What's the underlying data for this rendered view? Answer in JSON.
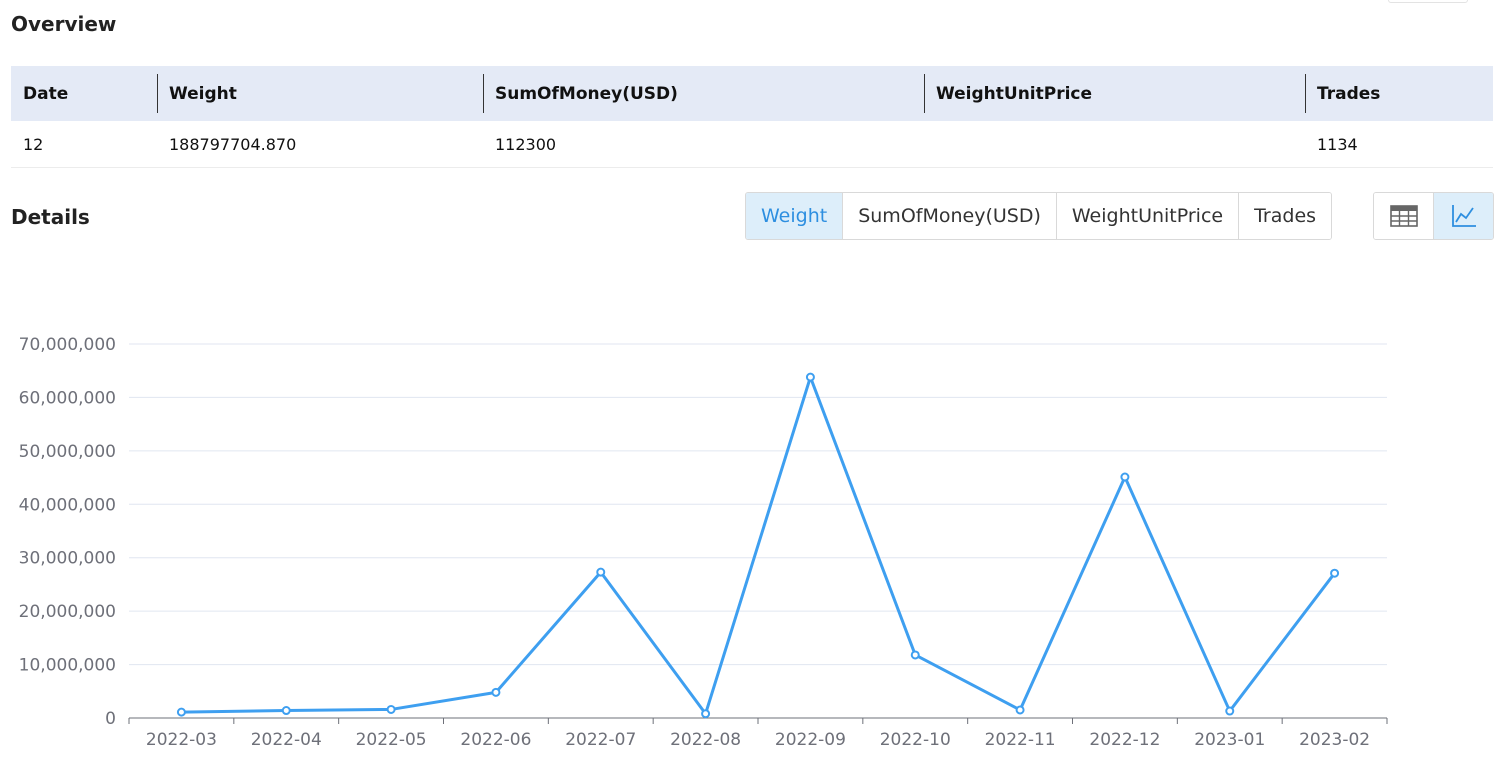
{
  "overview": {
    "title": "Overview",
    "columns": [
      "Date",
      "Weight",
      "SumOfMoney(USD)",
      "WeightUnitPrice",
      "Trades"
    ],
    "row": [
      "12",
      "188797704.870",
      "112300",
      "",
      "1134"
    ]
  },
  "details": {
    "title": "Details",
    "tabs": [
      {
        "label": "Weight",
        "active": true
      },
      {
        "label": "SumOfMoney(USD)",
        "active": false
      },
      {
        "label": "WeightUnitPrice",
        "active": false
      },
      {
        "label": "Trades",
        "active": false
      }
    ],
    "view_toggle": [
      {
        "icon": "table-icon",
        "active": false
      },
      {
        "icon": "line-chart-icon",
        "active": true
      }
    ]
  },
  "colors": {
    "series": "#3e9ff0",
    "active_tab_bg": "#ddeefa",
    "active_tab_text": "#2e8fe0",
    "header_bg": "#e4eaf6",
    "grid": "#e0e6f1",
    "axis": "#6e7079"
  },
  "chart_data": {
    "type": "line",
    "categories": [
      "2022-03",
      "2022-04",
      "2022-05",
      "2022-06",
      "2022-07",
      "2022-08",
      "2022-09",
      "2022-10",
      "2022-11",
      "2022-12",
      "2023-01",
      "2023-02"
    ],
    "series": [
      {
        "values": [
          1100000,
          1400000,
          1600000,
          4800000,
          27300000,
          800000,
          63800000,
          11800000,
          1500000,
          45100000,
          1300000,
          27100000
        ]
      }
    ],
    "ylim": [
      0,
      70000000
    ],
    "yticks": [
      0,
      10000000,
      20000000,
      30000000,
      40000000,
      50000000,
      60000000,
      70000000
    ],
    "ytick_labels": [
      "0",
      "10,000,000",
      "20,000,000",
      "30,000,000",
      "40,000,000",
      "50,000,000",
      "60,000,000",
      "70,000,000"
    ],
    "grid": true,
    "xlabel": "",
    "ylabel": ""
  }
}
